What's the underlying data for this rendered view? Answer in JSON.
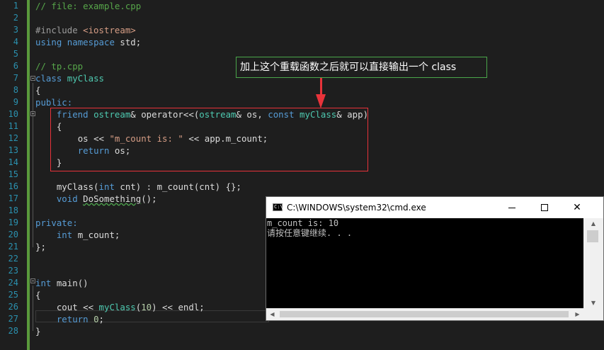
{
  "editor": {
    "line_numbers": [
      "1",
      "2",
      "3",
      "4",
      "5",
      "6",
      "7",
      "8",
      "9",
      "10",
      "11",
      "12",
      "13",
      "14",
      "15",
      "16",
      "17",
      "18",
      "19",
      "20",
      "21",
      "22",
      "23",
      "24",
      "25",
      "26",
      "27",
      "28"
    ],
    "code": {
      "l1": "// file: example.cpp",
      "l3_pp": "#include ",
      "l3_inc": "<iostream>",
      "l4_kw1": "using",
      "l4_kw2": "namespace",
      "l4_rest": " std;",
      "l6": "// tp.cpp",
      "l7_kw": "class",
      "l7_name": "myClass",
      "l8": "{",
      "l9": "public:",
      "l10_kw": "friend",
      "l10_t1": "ostream",
      "l10_a": "& operator<<(",
      "l10_t2": "ostream",
      "l10_b": "& os, ",
      "l10_kw2": "const",
      "l10_t3": "myClass",
      "l10_c": "& app)",
      "l11": "{",
      "l12_a": "os << ",
      "l12_str": "\"m_count is: \"",
      "l12_b": " << app.m_count;",
      "l13_kw": "return",
      "l13_rest": " os;",
      "l14": "}",
      "l16_a": "myClass(",
      "l16_kw": "int",
      "l16_b": " cnt) : m_count(cnt) {};",
      "l17_kw": "void",
      "l17_fn": "DoSomething",
      "l17_rest": "();",
      "l19": "private:",
      "l20_kw": "int",
      "l20_rest": " m_count;",
      "l21": "};",
      "l24_kw": "int",
      "l24_rest": " main()",
      "l25": "{",
      "l26_a": "cout << ",
      "l26_t": "myClass",
      "l26_b": "(",
      "l26_num": "10",
      "l26_c": ") << endl;",
      "l27_kw": "return",
      "l27_num": "0",
      "l27_rest": ";",
      "l28": "}"
    }
  },
  "annotation": {
    "callout_text": "加上这个重载函数之后就可以直接输出一个 class",
    "box_color": "#e8333a",
    "callout_border": "#4aa64a"
  },
  "cmd_window": {
    "title": "C:\\WINDOWS\\system32\\cmd.exe",
    "icon": "cmd-icon",
    "icon_label": "C:\\",
    "close_label": "✕",
    "output": [
      "m_count is: 10",
      "请按任意键继续. . ."
    ]
  },
  "colors": {
    "editor_bg": "#1e1e1e",
    "keyword": "#569cd6",
    "type": "#4ec9b0",
    "comment": "#57a64a",
    "string": "#d69d85",
    "line_number": "#2b91af"
  }
}
